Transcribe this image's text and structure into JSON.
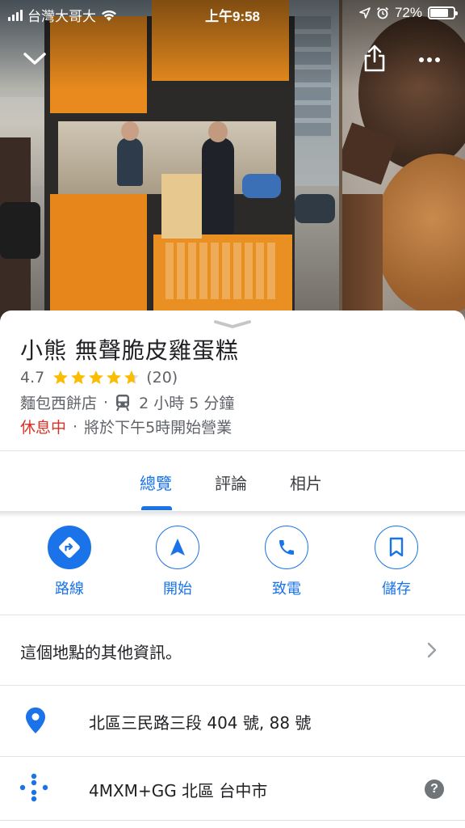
{
  "status_bar": {
    "carrier": "台灣大哥大",
    "time": "上午9:58",
    "battery": "72%"
  },
  "place": {
    "name": "小熊 無聲脆皮雞蛋糕",
    "rating": "4.7",
    "rating_value": 4.7,
    "review_count": "(20)",
    "category": "麵包西餅店",
    "transit_time": "2 小時 5 分鐘",
    "status": "休息中",
    "opens": "將於下午5時開始營業"
  },
  "tabs": [
    {
      "label": "總覽",
      "active": true
    },
    {
      "label": "評論",
      "active": false
    },
    {
      "label": "相片",
      "active": false
    }
  ],
  "actions": [
    {
      "label": "路線",
      "icon": "directions-icon"
    },
    {
      "label": "開始",
      "icon": "navigation-icon"
    },
    {
      "label": "致電",
      "icon": "phone-icon"
    },
    {
      "label": "儲存",
      "icon": "bookmark-icon"
    }
  ],
  "rows": {
    "more_info": "這個地點的其他資訊。",
    "address": "北區三民路三段 404 號, 88 號",
    "plus_code": "4MXM+GG 北區 台中市"
  },
  "colors": {
    "accent": "#1a73e8",
    "closed": "#d93025",
    "star": "#fbbc04",
    "pin": "#1a73e8"
  }
}
